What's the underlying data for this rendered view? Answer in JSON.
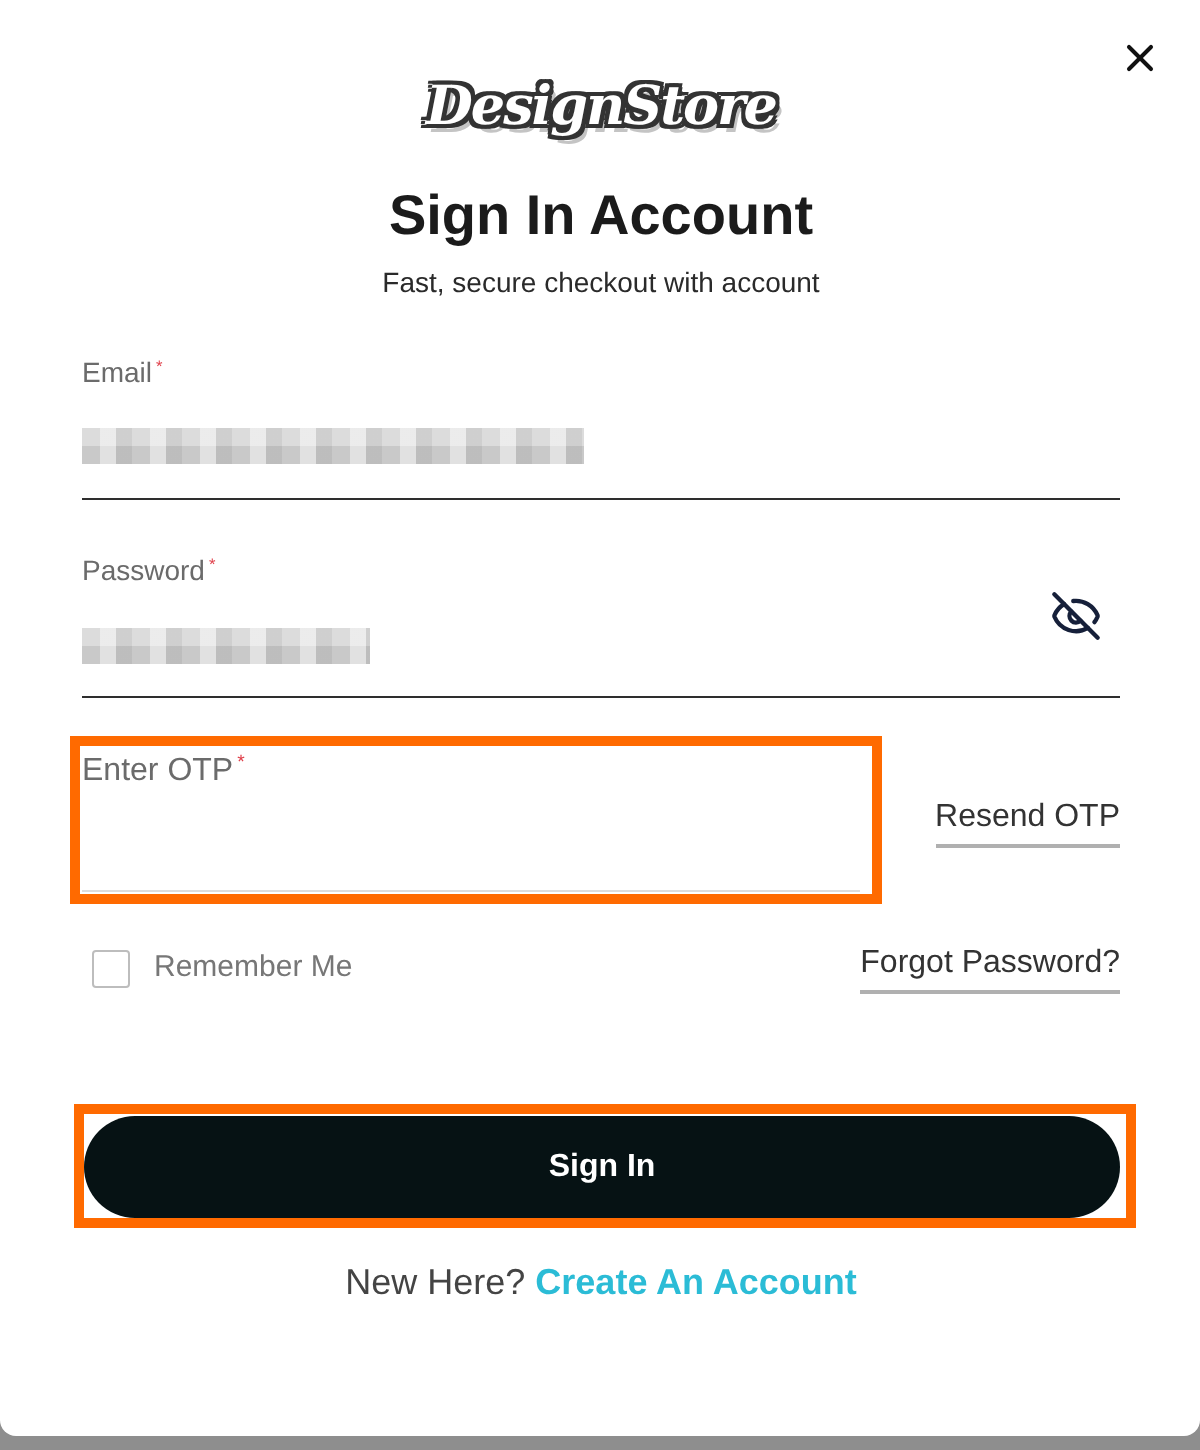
{
  "logo": "DesignStore",
  "title": "Sign In Account",
  "subtitle": "Fast, secure checkout with account",
  "fields": [
    {
      "kind": "email",
      "label": "Email$^{*}$",
      "value_blurred": true
    },
    {
      "kind": "password",
      "label": "Password$^{*}$",
      "value_blurred": true
    }
  ],
  "otp": {
    "label": "Enter OTP$^{*}$",
    "highlighted": true,
    "resend_link": "Resend OTP"
  },
  "remember_me": {
    "label": "Remember Me",
    "checked": false
  },
  "forgot_link": "Forgot Password?",
  "sign_in_button": {
    "label": "Sign In",
    "highlighted": true
  },
  "signup_prompt": {
    "text": "New Here?",
    "link": "Create An Account"
  }
}
